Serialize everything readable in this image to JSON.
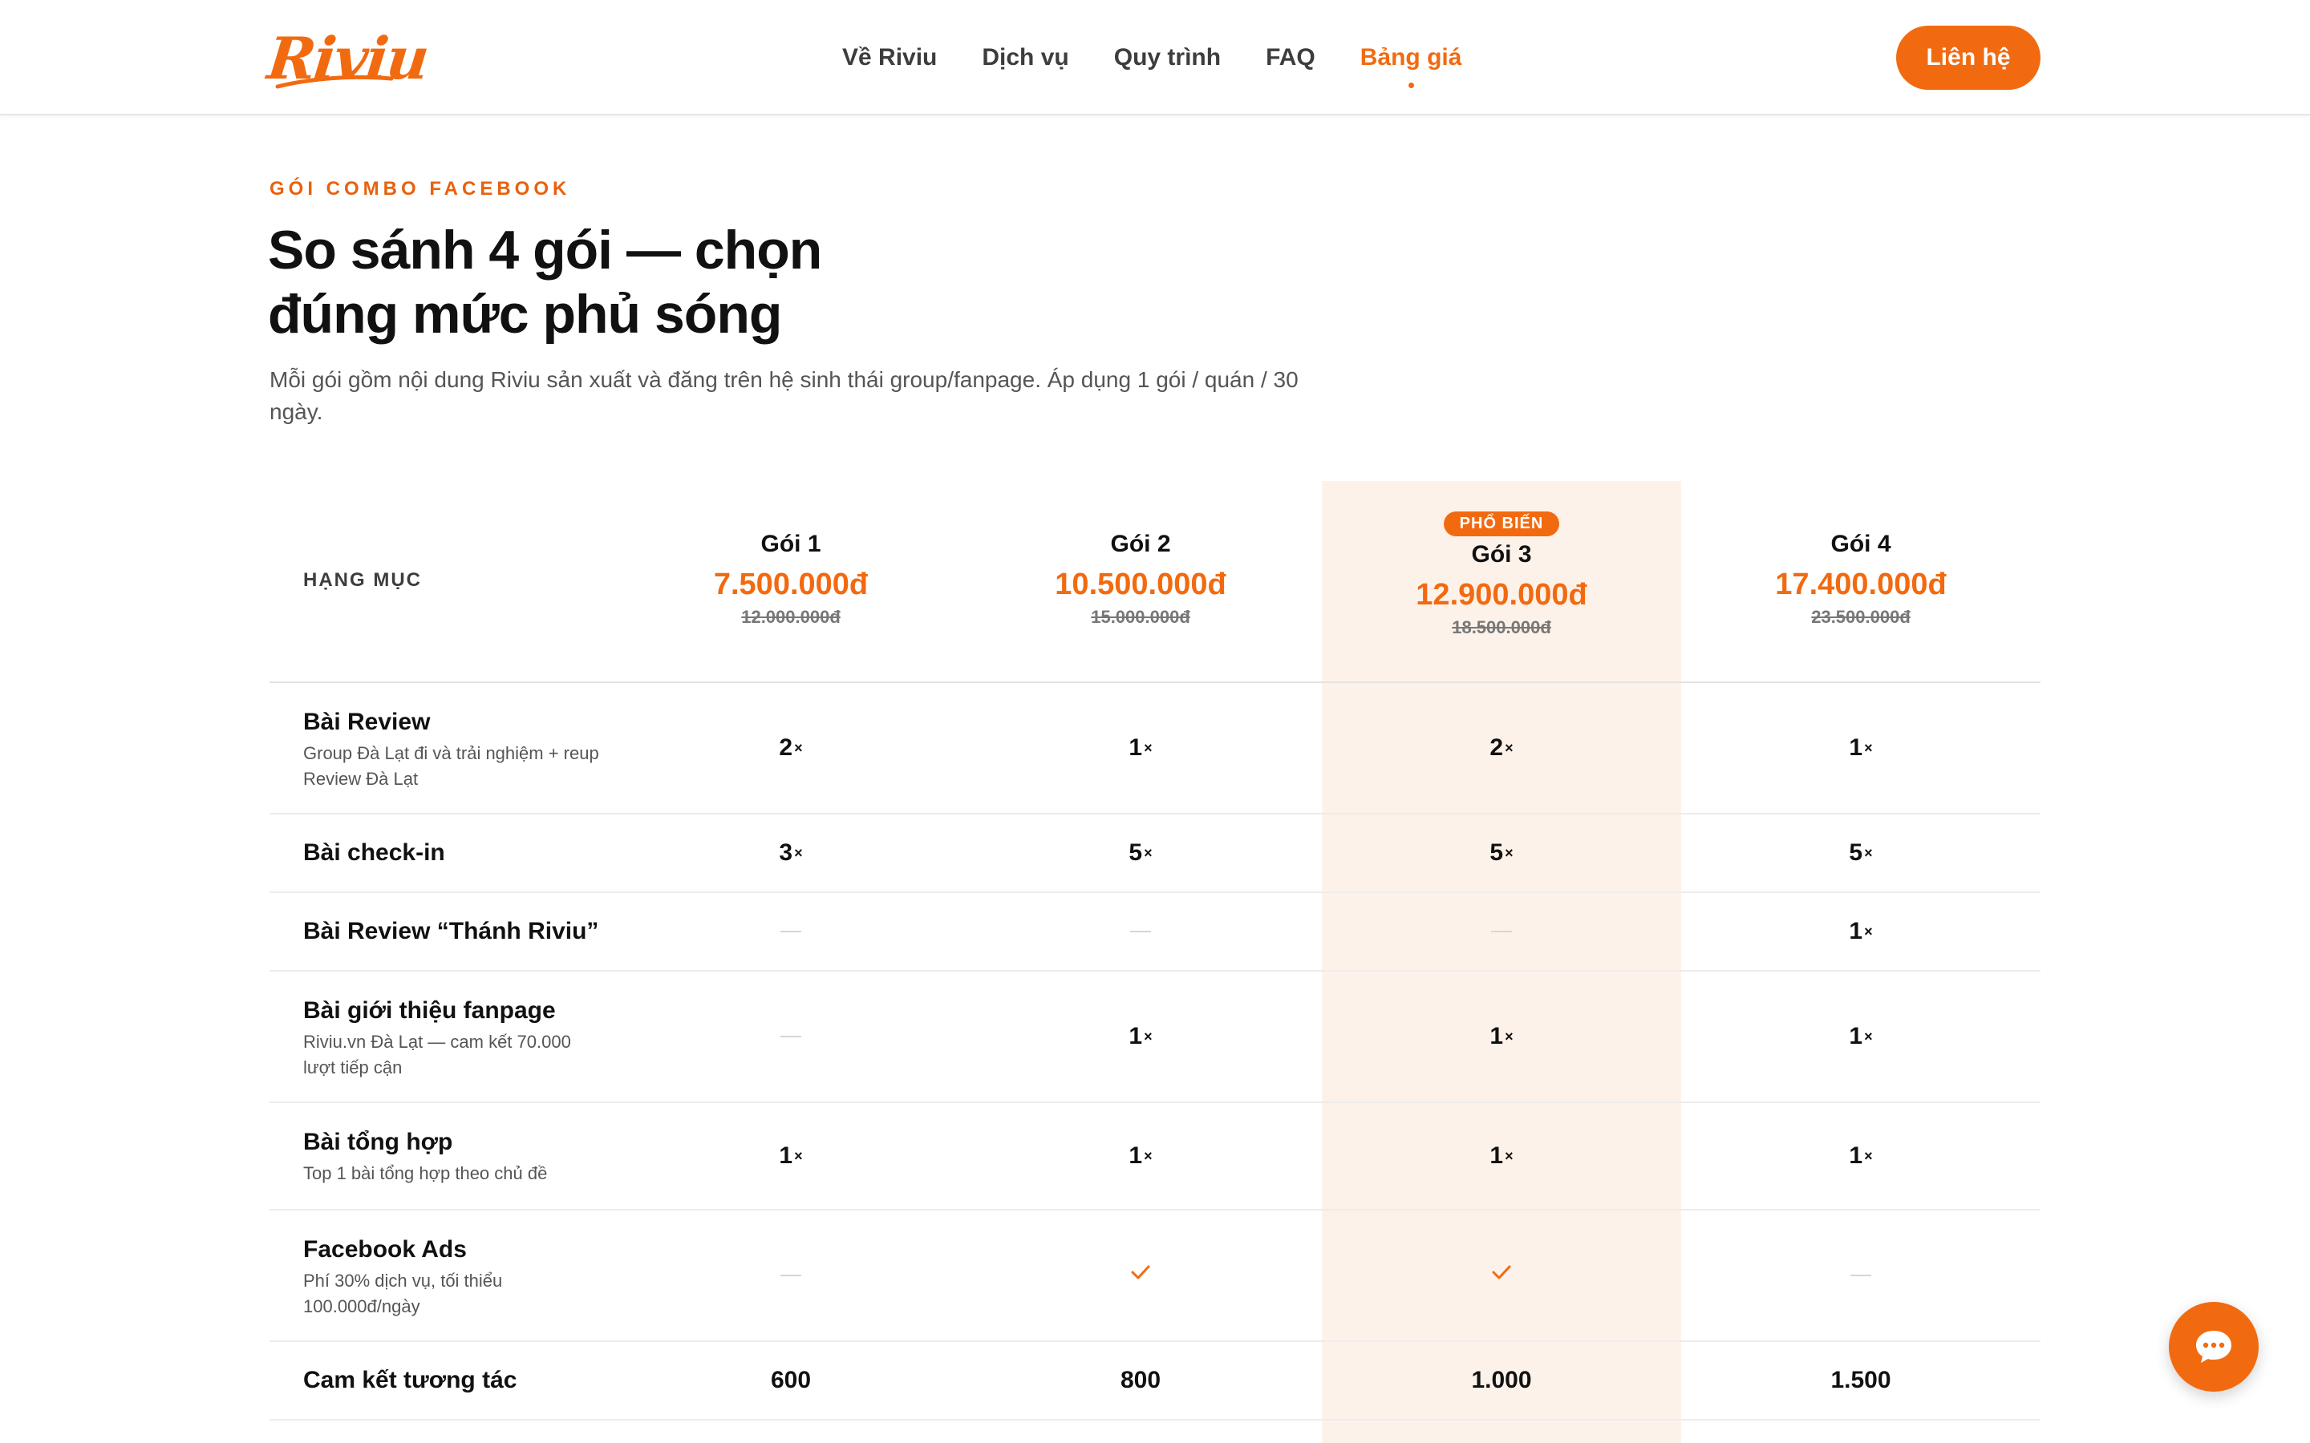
{
  "brand": {
    "logo_text": "Riviu",
    "accent": "#f26a10"
  },
  "nav": {
    "items": [
      {
        "label": "Về Riviu",
        "active": false
      },
      {
        "label": "Dịch vụ",
        "active": false
      },
      {
        "label": "Quy trình",
        "active": false
      },
      {
        "label": "FAQ",
        "active": false
      },
      {
        "label": "Bảng giá",
        "active": true
      }
    ],
    "cta_label": "Liên hệ"
  },
  "intro": {
    "eyebrow": "GÓI COMBO FACEBOOK",
    "title_line1": "So sánh 4 gói — chọn",
    "title_line2": "đúng mức phủ sóng",
    "description": "Mỗi gói gồm nội dung Riviu sản xuất và đăng trên hệ sinh thái group/fanpage. Áp dụng 1 gói / quán / 30 ngày."
  },
  "table": {
    "category_header": "HẠNG MỤC",
    "plans": [
      {
        "name": "Gói 1",
        "price": "7.500.000đ",
        "old_price": "12.000.000đ",
        "badge": ""
      },
      {
        "name": "Gói 2",
        "price": "10.500.000đ",
        "old_price": "15.000.000đ",
        "badge": ""
      },
      {
        "name": "Gói 3",
        "price": "12.900.000đ",
        "old_price": "18.500.000đ",
        "badge": "PHỔ BIẾN"
      },
      {
        "name": "Gói 4",
        "price": "17.400.000đ",
        "old_price": "23.500.000đ",
        "badge": ""
      }
    ],
    "rows": [
      {
        "title": "Bài Review",
        "subtitle": "Group Đà Lạt đi và trải nghiệm + reup Review Đà Lạt",
        "values": [
          "2",
          "1",
          "2",
          "1"
        ]
      },
      {
        "title": "Bài check-in",
        "subtitle": "",
        "values": [
          "3",
          "5",
          "5",
          "5"
        ]
      },
      {
        "title": "Bài Review “Thánh Riviu”",
        "subtitle": "",
        "values": [
          "-",
          "-",
          "-",
          "1"
        ]
      },
      {
        "title": "Bài giới thiệu fanpage",
        "subtitle": "Riviu.vn Đà Lạt — cam kết 70.000 lượt tiếp cận",
        "values": [
          "-",
          "1",
          "1",
          "1"
        ]
      },
      {
        "title": "Bài tổng hợp",
        "subtitle": "Top 1 bài tổng hợp theo chủ đề",
        "values": [
          "1",
          "1",
          "1",
          "1"
        ]
      },
      {
        "title": "Facebook Ads",
        "subtitle": "Phí 30% dịch vụ, tối thiểu 100.000đ/ngày",
        "values": [
          "-",
          "check",
          "check",
          "-"
        ]
      },
      {
        "title": "Cam kết tương tác",
        "subtitle": "",
        "values": [
          "600",
          "800",
          "1.000",
          "1.500"
        ]
      }
    ],
    "multiplier_symbol": "×"
  }
}
